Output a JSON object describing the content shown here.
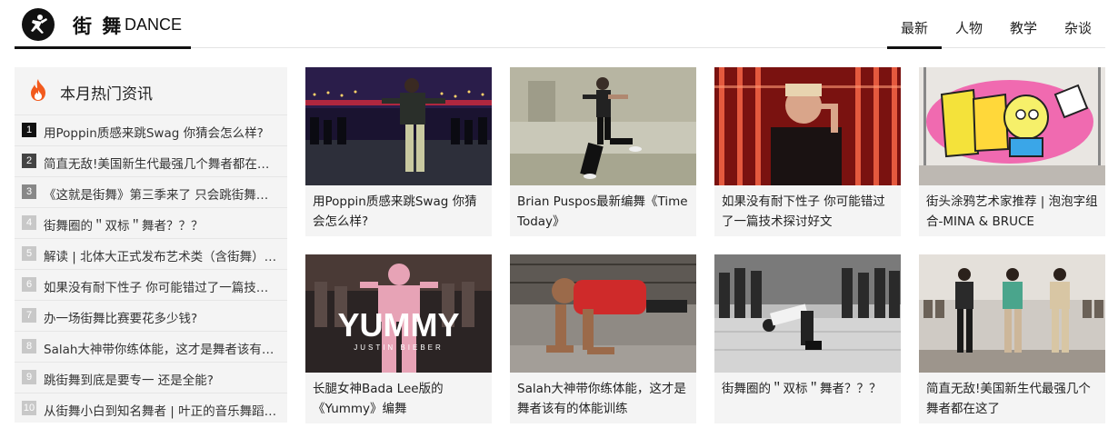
{
  "header": {
    "logo_icon": "dancer-logo-icon",
    "title": "街 舞",
    "subtitle": "DANCE",
    "nav": [
      {
        "label": "最新",
        "active": true
      },
      {
        "label": "人物",
        "active": false
      },
      {
        "label": "教学",
        "active": false
      },
      {
        "label": "杂谈",
        "active": false
      }
    ]
  },
  "sidebar": {
    "icon": "fire-icon",
    "title": "本月热门资讯",
    "items": [
      {
        "rank": "1",
        "text": "用Poppin质感来跳Swag 你猜会怎么样?"
      },
      {
        "rank": "2",
        "text": "简直无敌!美国新生代最强几个舞者都在这了"
      },
      {
        "rank": "3",
        "text": "《这就是街舞》第三季来了 只会跳街舞的舞者可能要凉了"
      },
      {
        "rank": "4",
        "text": "街舞圈的＂双标＂舞者？？？"
      },
      {
        "rank": "5",
        "text": "解读 | 北体大正式发布艺术类（含街舞）招生简章"
      },
      {
        "rank": "6",
        "text": "如果没有耐下性子 你可能错过了一篇技术探讨好文"
      },
      {
        "rank": "7",
        "text": "办一场街舞比赛要花多少钱?"
      },
      {
        "rank": "8",
        "text": "Salah大神带你练体能，这才是舞者该有的体能训练"
      },
      {
        "rank": "9",
        "text": "跳街舞到底是要专一 还是全能?"
      },
      {
        "rank": "10",
        "text": "从街舞小白到知名舞者 | 叶正的音乐舞蹈之路"
      }
    ]
  },
  "cards": [
    {
      "caption": "用Poppin质感来跳Swag 你猜会怎么样?"
    },
    {
      "caption": "Brian Puspos最新编舞《Time Today》"
    },
    {
      "caption": "如果没有耐下性子 你可能错过了一篇技术探讨好文"
    },
    {
      "caption": "街头涂鸦艺术家推荐 | 泡泡字组合-MINA & BRUCE"
    },
    {
      "caption": "长腿女神Bada Lee版的《Yummy》编舞",
      "thumb_title": "YUMMY",
      "thumb_sub": "JUSTIN BIEBER"
    },
    {
      "caption": "Salah大神带你练体能，这才是舞者该有的体能训练"
    },
    {
      "caption": "街舞圈的＂双标＂舞者？？？"
    },
    {
      "caption": "简直无敌!美国新生代最强几个舞者都在这了"
    }
  ]
}
